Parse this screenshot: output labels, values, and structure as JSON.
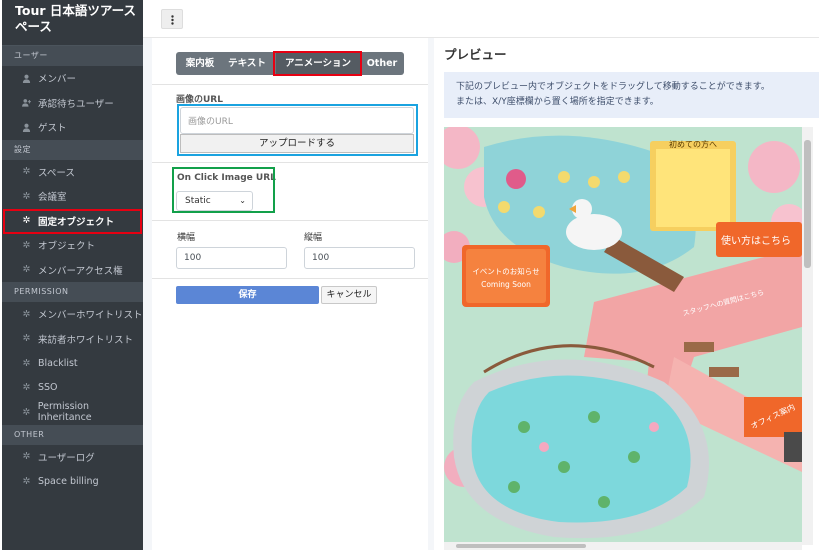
{
  "brand": {
    "line1": "Tour 日本語ツアース",
    "line2": "ペース"
  },
  "sidebar": {
    "sections": [
      {
        "header": "ユーザー",
        "items": [
          {
            "label": "メンバー",
            "icon": "user-icon"
          },
          {
            "label": "承認待ちユーザー",
            "icon": "user-plus-icon"
          },
          {
            "label": "ゲスト",
            "icon": "user-lock-icon"
          }
        ]
      },
      {
        "header": "設定",
        "items": [
          {
            "label": "スペース",
            "icon": "gear-icon"
          },
          {
            "label": "会議室",
            "icon": "gear-icon"
          },
          {
            "label": "固定オブジェクト",
            "icon": "gear-icon",
            "active": true
          },
          {
            "label": "オブジェクト",
            "icon": "gear-icon"
          },
          {
            "label": "メンバーアクセス権",
            "icon": "gear-icon"
          }
        ]
      },
      {
        "header": "PERMISSION",
        "items": [
          {
            "label": "メンバーホワイトリスト",
            "icon": "gear-icon"
          },
          {
            "label": "来訪者ホワイトリスト",
            "icon": "gear-icon"
          },
          {
            "label": "Blacklist",
            "icon": "gear-icon"
          },
          {
            "label": "SSO",
            "icon": "gear-icon"
          },
          {
            "label": "Permission Inheritance",
            "icon": "gear-icon"
          }
        ]
      },
      {
        "header": "OTHER",
        "items": [
          {
            "label": "ユーザーログ",
            "icon": "gear-icon"
          },
          {
            "label": "Space billing",
            "icon": "gear-icon"
          }
        ]
      }
    ]
  },
  "topbar": {
    "menu_icon": "kebab-icon"
  },
  "tabs": [
    {
      "label": "案内板"
    },
    {
      "label": "テキスト"
    },
    {
      "label": "アニメーション",
      "active": true
    },
    {
      "label": "Other"
    }
  ],
  "form": {
    "image_url_label": "画像のURL",
    "image_url_placeholder": "画像のURL",
    "upload_label": "アップロードする",
    "onclick_label": "On Click Image URL",
    "onclick_value": "Static",
    "width_label": "横幅",
    "width_value": "100",
    "height_label": "縦幅",
    "height_value": "100",
    "save_label": "保存",
    "cancel_label": "キャンセル"
  },
  "preview": {
    "title": "プレビュー",
    "info_line1": "下記のプレビュー内でオブジェクトをドラッグして移動することができます。",
    "info_line2": "または、X/Y座標欄から置く場所を指定できます。",
    "sign_first_time": "初めての方へ",
    "sign_how_to": "使い方はこちら",
    "sign_event_line1": "イベントのお知らせ",
    "sign_event_line2": "Coming Soon",
    "sign_staff": "スタッフへの質問はこちら",
    "sign_office": "オフィス案内"
  },
  "colors": {
    "sidebar_bg": "#343a40",
    "highlight_red": "#e60012",
    "highlight_blue": "#1aa3e0",
    "highlight_green": "#12a04a",
    "save_btn": "#5b86d6"
  }
}
